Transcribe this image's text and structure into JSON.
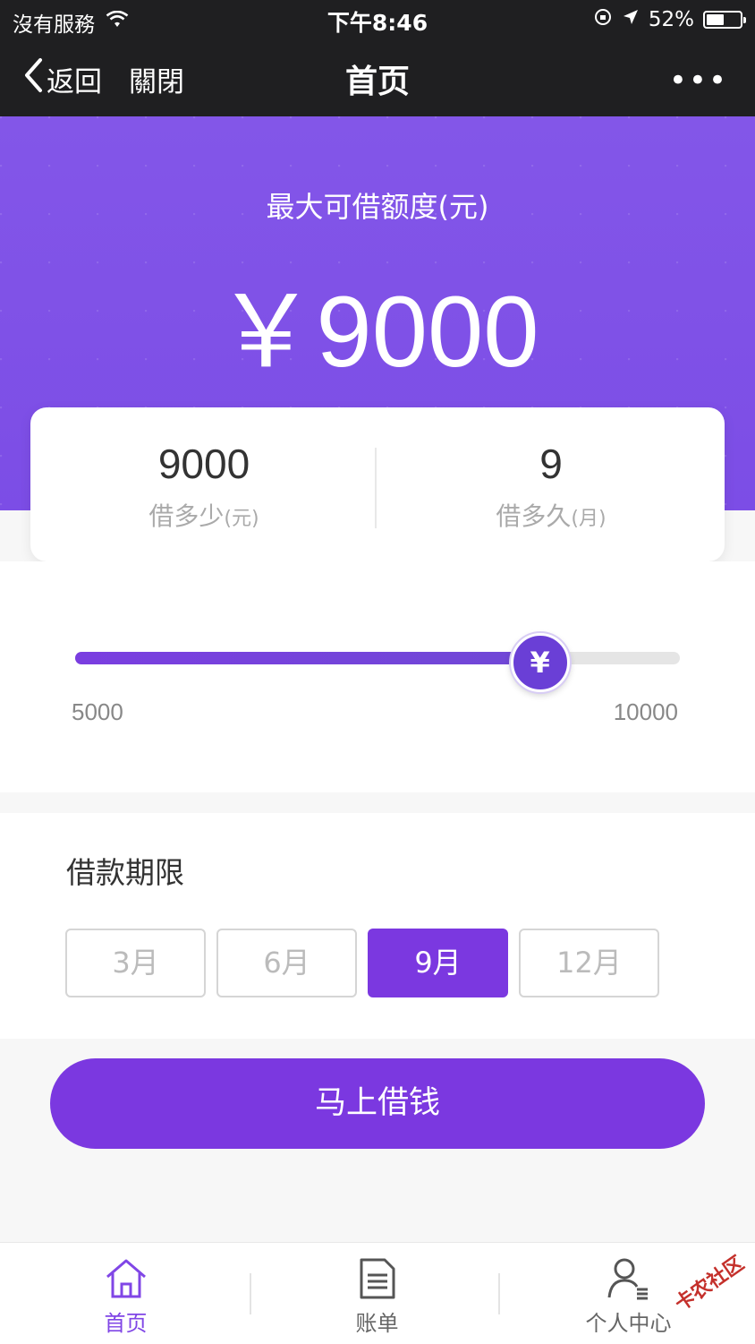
{
  "status_bar": {
    "carrier": "沒有服務",
    "time": "下午8:46",
    "battery_text": "52%",
    "battery_level": 0.52
  },
  "nav": {
    "back_label": "返回",
    "close_label": "關閉",
    "title": "首页",
    "more_label": "•••"
  },
  "hero": {
    "label": "最大可借额度(元)",
    "amount": "￥9000"
  },
  "summary": {
    "amount_value": "9000",
    "amount_label": "借多少",
    "amount_unit": "(元)",
    "term_value": "9",
    "term_label": "借多久",
    "term_unit": "(月)"
  },
  "slider": {
    "min_label": "5000",
    "max_label": "10000",
    "min": 5000,
    "max": 10000,
    "value": 9000,
    "thumb_symbol": "¥"
  },
  "term": {
    "title": "借款期限",
    "options": [
      "3月",
      "6月",
      "9月",
      "12月"
    ],
    "selected": "9月"
  },
  "cta_label": "马上借钱",
  "tabs": [
    {
      "label": "首页",
      "icon": "home-icon",
      "active": true
    },
    {
      "label": "账单",
      "icon": "bill-icon",
      "active": false
    },
    {
      "label": "个人中心",
      "icon": "user-icon",
      "active": false
    }
  ],
  "watermark": "卡农社区",
  "colors": {
    "accent": "#7b38e0",
    "hero": "#8356e8",
    "dark_bar": "#1f1f21"
  }
}
